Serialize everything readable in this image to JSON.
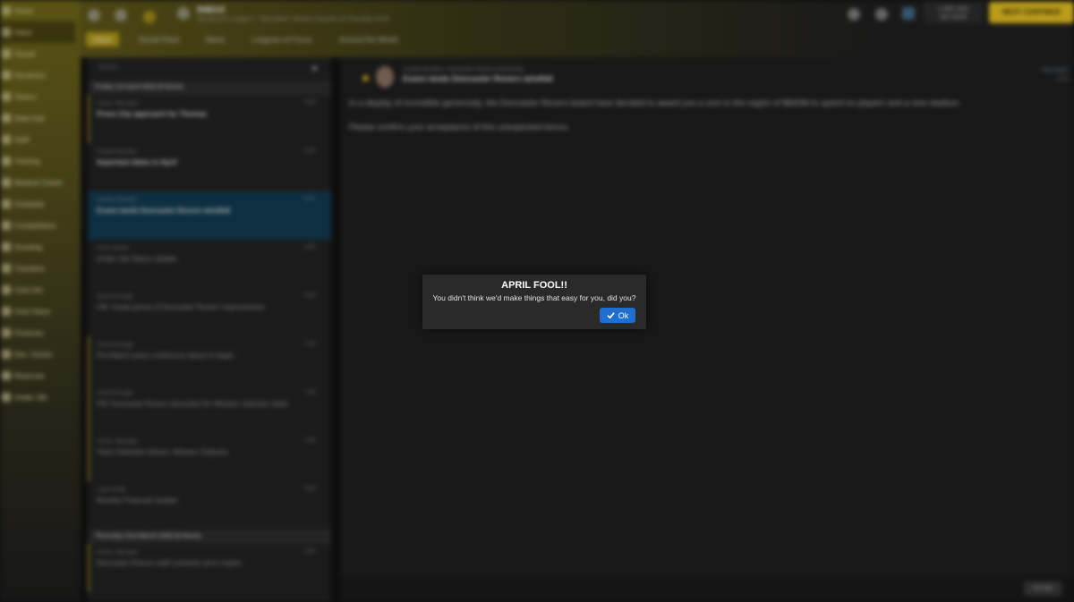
{
  "sidebar": {
    "items": [
      {
        "label": "Home"
      },
      {
        "label": "Inbox"
      },
      {
        "label": "Squad"
      },
      {
        "label": "Dynamics"
      },
      {
        "label": "Tactics"
      },
      {
        "label": "Data Hub"
      },
      {
        "label": "Staff"
      },
      {
        "label": "Training"
      },
      {
        "label": "Medical Centre"
      },
      {
        "label": "Schedule"
      },
      {
        "label": "Competitions"
      },
      {
        "label": "Scouting"
      },
      {
        "label": "Transfers"
      },
      {
        "label": "Club Info"
      },
      {
        "label": "Club Vision"
      },
      {
        "label": "Finances"
      },
      {
        "label": "Dev. Centre"
      },
      {
        "label": "Reserves"
      },
      {
        "label": "Under 18s"
      }
    ]
  },
  "header": {
    "title": "INBOX",
    "breadcrumb": "Sky Bet EFL League 2 · Next Match: Western Suburbs (A) Thursday 20:00",
    "tabs": [
      "Inbox",
      "Social Feed",
      "News",
      "Leagues of Focus",
      "Around the World"
    ],
    "money": {
      "amount": "1 APR 2022",
      "sub": "SAT 08:00"
    },
    "continue_label": "NEXT CONTINUE"
  },
  "inbox": {
    "search_placeholder": "Search",
    "days": [
      {
        "header": "Friday 1st April 2022 (9 Items)",
        "messages": [
          {
            "from": "Assist. Manager",
            "subject": "Press City approach for Thomas",
            "time": "9:00"
          },
          {
            "from": "Amelia Moulder",
            "subject": "Important dates in April",
            "time": "8:45"
          },
          {
            "from": "Amelia Moulder",
            "subject": "Evans lands Doncaster Rovers windfall",
            "time": "8:00"
          },
          {
            "from": "Chris Hamill",
            "subject": "Under 18s Status Update",
            "time": "8:00"
          },
          {
            "from": "Scott Everage",
            "subject": "FM: Grade prices of Doncaster Rovers' improvement",
            "time": "8:00"
          },
          {
            "from": "Scott Everage",
            "subject": "Pre-Match press conference about to begin",
            "time": "7:30"
          },
          {
            "from": "Scott Everage",
            "subject": "FM: Doncaster Rovers favourites for Western Suburbs clash",
            "time": "7:00"
          },
          {
            "from": "Assist. Manager",
            "subject": "Team Selection Advice: Western Suburbs",
            "time": "7:00"
          },
          {
            "from": "Luke Smith",
            "subject": "Monthly Financial Update",
            "time": "6:00"
          }
        ]
      },
      {
        "header": "Thursday 31st March 2022 (6 Items)",
        "messages": [
          {
            "from": "Assist. Manager",
            "subject": "Doncaster Rovers staff contracts set to expire",
            "time": "9:00"
          }
        ]
      }
    ]
  },
  "detail": {
    "from": "Amelia Moulder | Doncaster Rovers (Honorary)",
    "subject": "Evans lands Doncaster Rovers windfall",
    "meta_link": "Messages",
    "meta_time": "8:00",
    "paragraphs": [
      "In a display of incredible generosity, the Doncaster Rovers board have decided to award you a sum in the region of $840M to spend on players and a new stadium.",
      "Please confirm your acceptance of this unexpected bonus."
    ],
    "accept_label": "Accept"
  },
  "dialog": {
    "title": "APRIL FOOL!!",
    "text": "You didn't think we'd make things that easy for you, did you?",
    "ok_label": "Ok"
  }
}
